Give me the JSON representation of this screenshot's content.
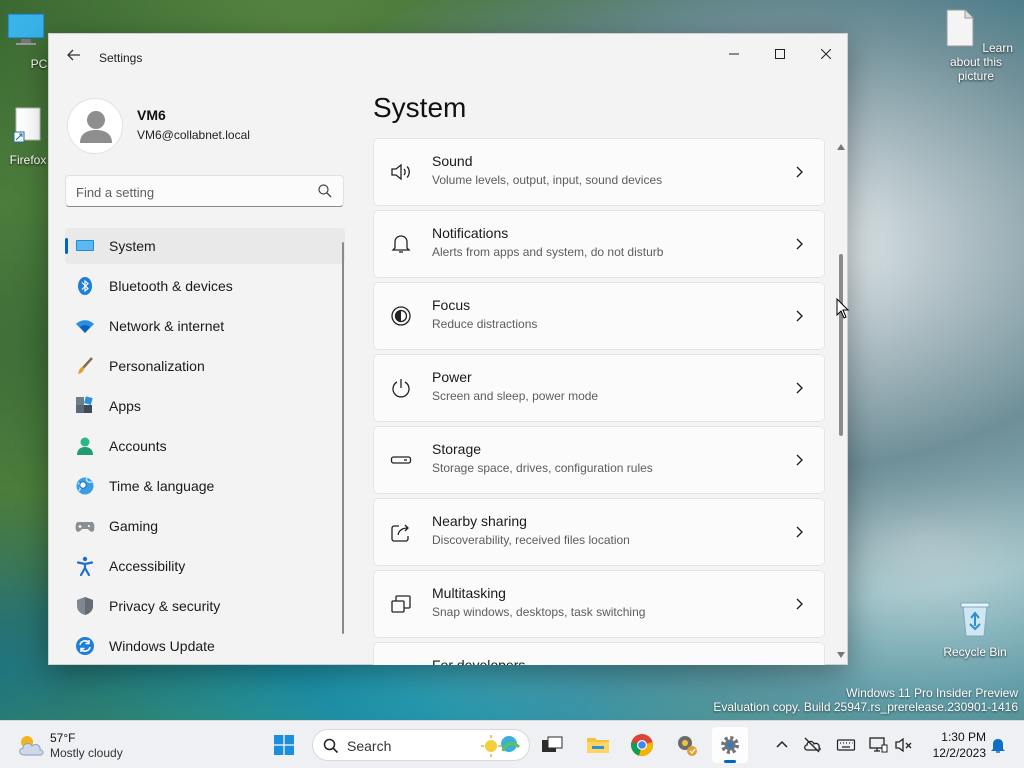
{
  "desktop": {
    "icons": [
      {
        "label": "This PC"
      },
      {
        "label": "Firefox"
      },
      {
        "label": "Learn about this picture"
      },
      {
        "label": "Recycle Bin"
      }
    ],
    "watermark_line1": "Windows 11 Pro Insider Preview",
    "watermark_line2": "Evaluation copy. Build 25947.rs_prerelease.230901-1416"
  },
  "window": {
    "app_title": "Settings",
    "minimize_label": "—",
    "maximize_label": "☐",
    "close_label": "✕"
  },
  "profile": {
    "name": "VM6",
    "email": "VM6@collabnet.local"
  },
  "search": {
    "placeholder": "Find a setting"
  },
  "sidebar": {
    "items": [
      {
        "label": "System",
        "active": true
      },
      {
        "label": "Bluetooth & devices"
      },
      {
        "label": "Network & internet"
      },
      {
        "label": "Personalization"
      },
      {
        "label": "Apps"
      },
      {
        "label": "Accounts"
      },
      {
        "label": "Time & language"
      },
      {
        "label": "Gaming"
      },
      {
        "label": "Accessibility"
      },
      {
        "label": "Privacy & security"
      },
      {
        "label": "Windows Update"
      }
    ]
  },
  "main": {
    "title": "System",
    "cards": [
      {
        "title": "Sound",
        "desc": "Volume levels, output, input, sound devices",
        "icon": "speaker-icon"
      },
      {
        "title": "Notifications",
        "desc": "Alerts from apps and system, do not disturb",
        "icon": "bell-icon"
      },
      {
        "title": "Focus",
        "desc": "Reduce distractions",
        "icon": "focus-icon"
      },
      {
        "title": "Power",
        "desc": "Screen and sleep, power mode",
        "icon": "power-icon"
      },
      {
        "title": "Storage",
        "desc": "Storage space, drives, configuration rules",
        "icon": "storage-icon"
      },
      {
        "title": "Nearby sharing",
        "desc": "Discoverability, received files location",
        "icon": "share-icon"
      },
      {
        "title": "Multitasking",
        "desc": "Snap windows, desktops, task switching",
        "icon": "multitasking-icon"
      },
      {
        "title": "For developers",
        "desc": "",
        "icon": "developer-icon"
      }
    ]
  },
  "taskbar": {
    "weather_temp": "57°F",
    "weather_desc": "Mostly cloudy",
    "search_label": "Search",
    "time": "1:30 PM",
    "date": "12/2/2023"
  },
  "colors": {
    "accent": "#0067c0"
  }
}
